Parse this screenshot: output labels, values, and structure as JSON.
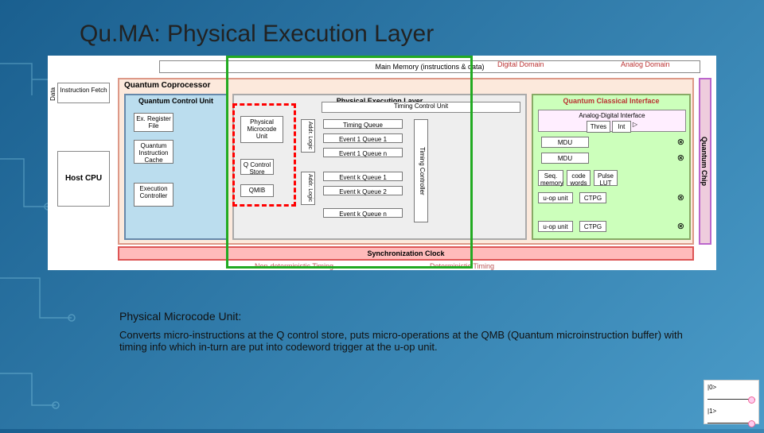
{
  "title": "Qu.MA: Physical Execution Layer",
  "mainMemory": "Main Memory (instructions & data)",
  "digitalDomain": "Digital Domain",
  "analogDomain": "Analog Domain",
  "coprocessor": "Quantum Coprocessor",
  "hostCpu": "Host CPU",
  "instructionFetch": "Instruction Fetch",
  "dataLbl": "Data",
  "qcu": {
    "label": "Quantum Control Unit",
    "exReg": "Ex. Register File",
    "qic": "Quantum Instruction Cache",
    "exec": "Execution Controller"
  },
  "pel": {
    "label": "Physical Execution Layer",
    "pmu": "Physical Microcode Unit",
    "qcs": "Q Control Store",
    "qmib": "QMIB",
    "tcu": "Timing Control Unit",
    "tq": "Timing Queue",
    "e1q1": "Event 1 Queue 1",
    "e1qn": "Event 1 Queue n",
    "ekq1": "Event k Queue 1",
    "ekq2": "Event k Queue 2",
    "ekqn": "Event k Queue n",
    "addrLogic": "Addr. Logic",
    "tctrl": "Timing Controller"
  },
  "qci": {
    "label": "Quantum Classical Interface",
    "adi": "Analog-Digital Interface",
    "thres": "Thres",
    "int": "Int",
    "mdu": "MDU",
    "seq": "Seq. memory",
    "code": "code words",
    "pulse": "Pulse LUT",
    "uop": "u-op unit",
    "ctpg": "CTPG"
  },
  "syncClock": "Synchronization Clock",
  "nonDetTiming": "Non-deterministic Timing",
  "detTiming": "Deterministic Timing",
  "quantumChip": "Quantum Chip",
  "caption": {
    "heading": "Physical Microcode Unit:",
    "body": "Converts micro-instructions at the Q control store, puts micro-operations at the QMB (Quantum microinstruction buffer) with timing info which in-turn are put into codeword trigger at the u-op unit."
  },
  "ket0": "|0>",
  "ket1": "|1>"
}
